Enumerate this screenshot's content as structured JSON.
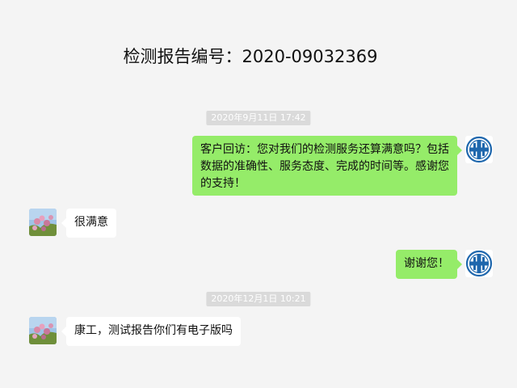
{
  "header": {
    "title": "检测报告编号：2020-09032369"
  },
  "messages": [
    {
      "timestamp": "2020年9月11日 17:42"
    },
    {
      "sender": "company",
      "text": "客户回访：您对我们的检测服务还算满意吗？包括数据的准确性、服务态度、完成的时间等。感谢您的支持！"
    },
    {
      "sender": "customer",
      "text": "很满意"
    },
    {
      "sender": "company",
      "text": "谢谢您！"
    },
    {
      "timestamp": "2020年12月1日 10:21"
    },
    {
      "sender": "customer",
      "text": "康工，测试报告你们有电子版吗"
    }
  ],
  "colors": {
    "background": "#f4f4f4",
    "outgoing_bubble": "#95ec69",
    "incoming_bubble": "#ffffff",
    "timestamp_badge": "#dadada",
    "company_logo_blue": "#1f67ad"
  },
  "icons": {
    "company_avatar": "company-logo-icon",
    "customer_avatar": "flower-photo-icon"
  }
}
